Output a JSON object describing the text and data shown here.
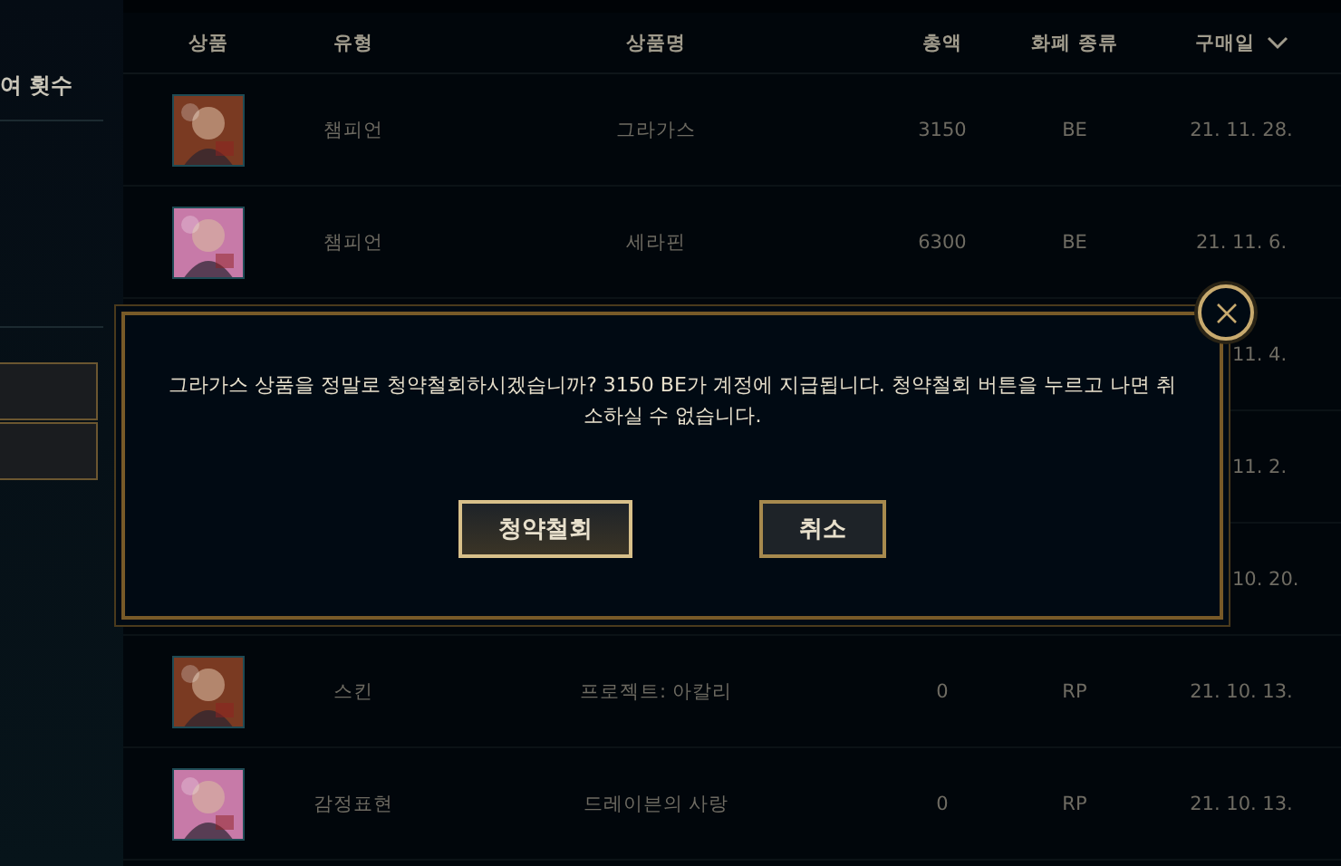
{
  "sidebar": {
    "heading": "여 횟수",
    "buttons": [
      {
        "kind": "button"
      },
      {
        "kind": "button"
      }
    ]
  },
  "table": {
    "columns": [
      {
        "label": "상품",
        "sorted": false
      },
      {
        "label": "유형",
        "sorted": false
      },
      {
        "label": "상품명",
        "sorted": false
      },
      {
        "label": "총액",
        "sorted": false
      },
      {
        "label": "화폐 종류",
        "sorted": false
      },
      {
        "label": "구매일",
        "sorted": true
      }
    ],
    "rows": [
      {
        "kind": "full",
        "type": "챔피언",
        "name": "그라가스",
        "total": "3150",
        "currency": "BE",
        "date": "21. 11. 28."
      },
      {
        "kind": "full",
        "type": "챔피언",
        "name": "세라핀",
        "total": "6300",
        "currency": "BE",
        "date": "21. 11. 6."
      },
      {
        "kind": "covered",
        "date": "11. 4."
      },
      {
        "kind": "covered",
        "date": "11. 2."
      },
      {
        "kind": "covered",
        "date": "10. 20."
      },
      {
        "kind": "full",
        "type": "스킨",
        "name": "프로젝트: 아칼리",
        "total": "0",
        "currency": "RP",
        "date": "21. 10. 13."
      },
      {
        "kind": "full",
        "type": "감정표현",
        "name": "드레이븐의 사랑",
        "total": "0",
        "currency": "RP",
        "date": "21. 10. 13."
      }
    ]
  },
  "dialog": {
    "message": "그라가스 상품을 정말로 청약철회하시겠습니까? 3150 BE가 계정에 지급됩니다. 청약철회 버튼을 누르고 나면 취소하실 수 없습니다.",
    "buttons": [
      {
        "label": "청약철회",
        "primary": true
      },
      {
        "label": "취소",
        "primary": false
      }
    ]
  }
}
